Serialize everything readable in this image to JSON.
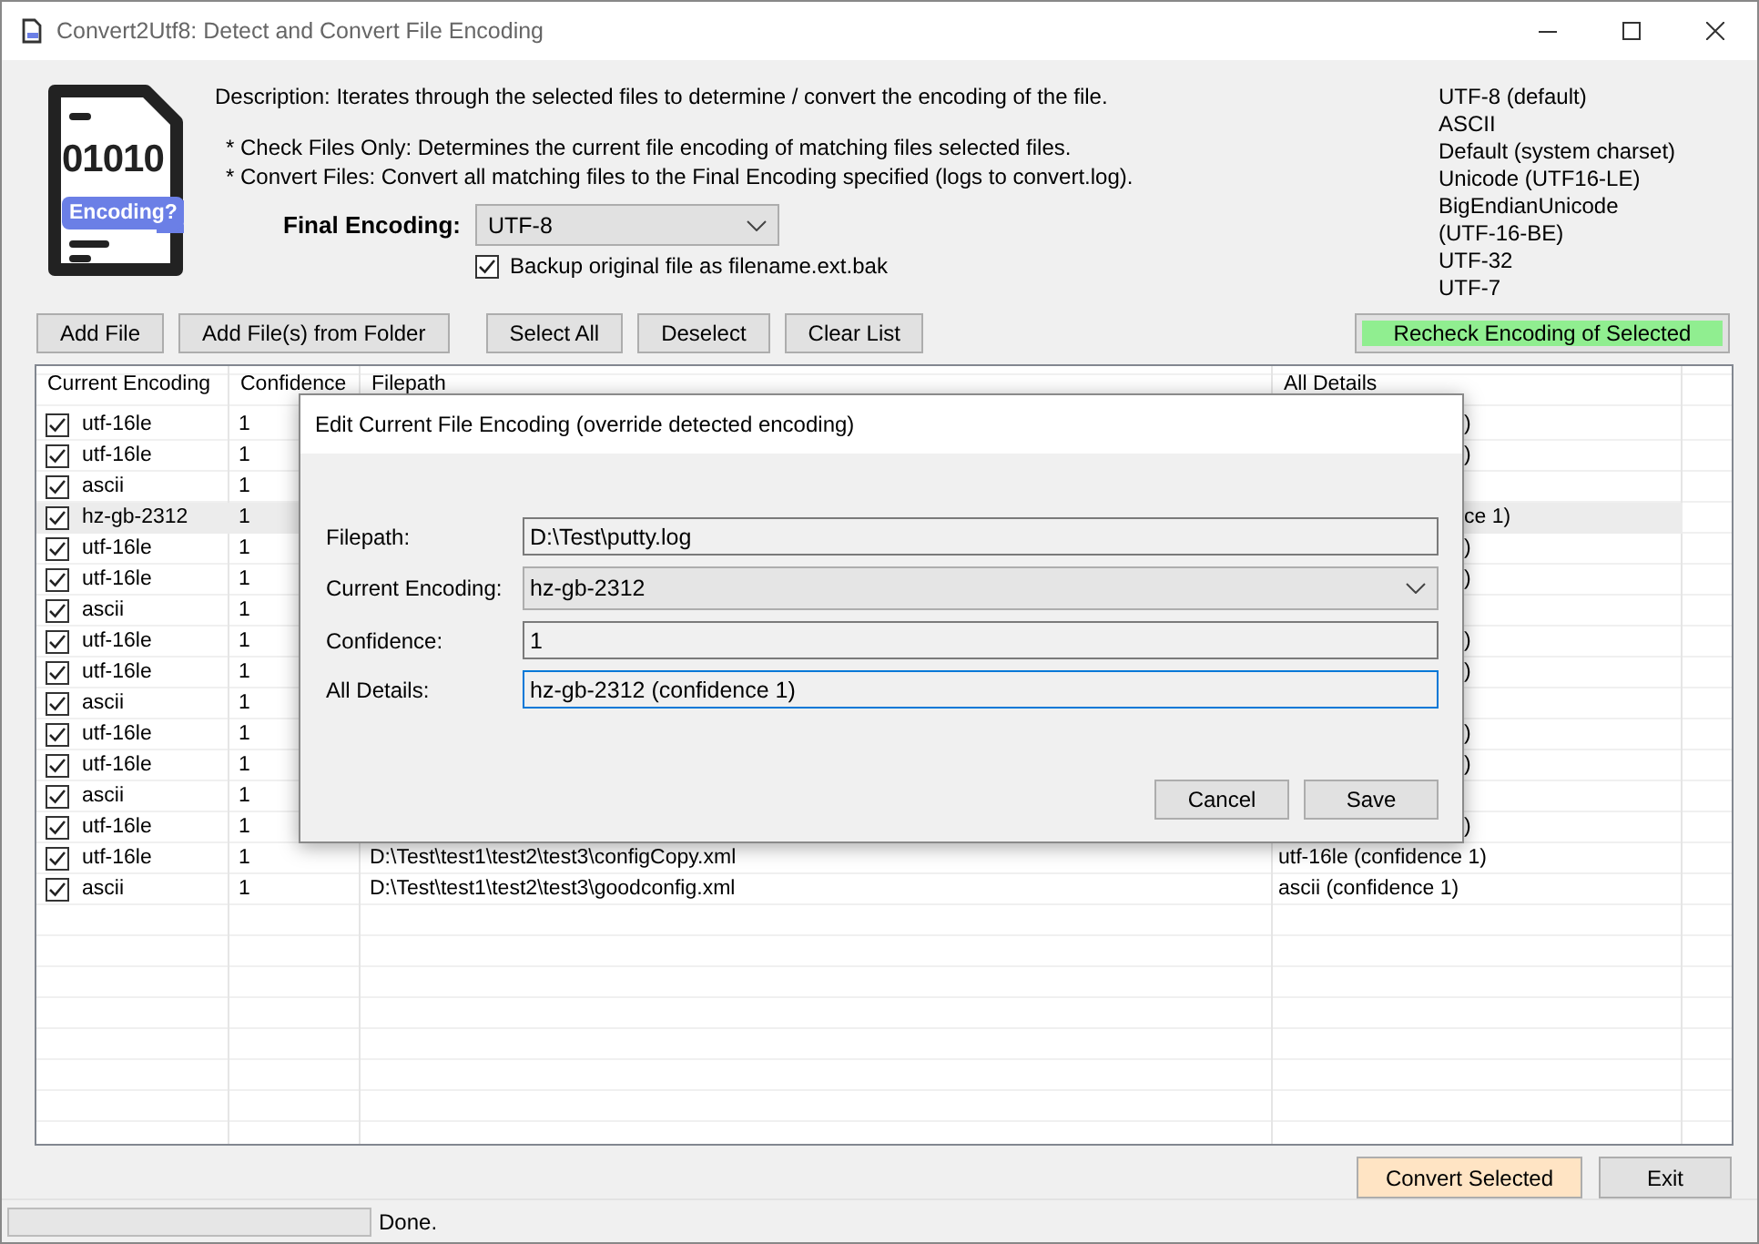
{
  "window": {
    "title": "Convert2Utf8: Detect and Convert File Encoding"
  },
  "logo": {
    "digits": "01010",
    "badge": "Encoding?"
  },
  "description": "Description: Iterates through the selected files to determine / convert the encoding of the file.",
  "notes": [
    "* Check Files Only: Determines the current file encoding of matching files selected files.",
    "* Convert Files: Convert all matching files to the Final Encoding specified (logs to convert.log)."
  ],
  "final_encoding": {
    "label": "Final Encoding:",
    "value": "UTF-8"
  },
  "backup": {
    "label": "Backup original file as filename.ext.bak",
    "checked": true
  },
  "encodings": [
    "UTF-8 (default)",
    "ASCII",
    "Default (system charset)",
    "Unicode (UTF16-LE)",
    "BigEndianUnicode",
    "(UTF-16-BE)",
    "UTF-32",
    "UTF-7"
  ],
  "toolbar": [
    "Add File",
    "Add File(s) from Folder",
    "Select All",
    "Deselect",
    "Clear List"
  ],
  "recheck_button": "Recheck Encoding of Selected",
  "table": {
    "columns": [
      "Current Encoding",
      "Confidence",
      "Filepath",
      "All Details"
    ],
    "rows": [
      {
        "checked": true,
        "selected": false,
        "encoding": "utf-16le",
        "confidence": "1",
        "all_details": ")"
      },
      {
        "checked": true,
        "selected": false,
        "encoding": "utf-16le",
        "confidence": "1",
        "all_details": ")"
      },
      {
        "checked": true,
        "selected": false,
        "encoding": "ascii",
        "confidence": "1"
      },
      {
        "checked": true,
        "selected": true,
        "encoding": "hz-gb-2312",
        "confidence": "1",
        "all_details": "ce 1)"
      },
      {
        "checked": true,
        "selected": false,
        "encoding": "utf-16le",
        "confidence": "1",
        "all_details": ")"
      },
      {
        "checked": true,
        "selected": false,
        "encoding": "utf-16le",
        "confidence": "1",
        "all_details": ")"
      },
      {
        "checked": true,
        "selected": false,
        "encoding": "ascii",
        "confidence": "1"
      },
      {
        "checked": true,
        "selected": false,
        "encoding": "utf-16le",
        "confidence": "1",
        "all_details": ")"
      },
      {
        "checked": true,
        "selected": false,
        "encoding": "utf-16le",
        "confidence": "1",
        "all_details": ")"
      },
      {
        "checked": true,
        "selected": false,
        "encoding": "ascii",
        "confidence": "1"
      },
      {
        "checked": true,
        "selected": false,
        "encoding": "utf-16le",
        "confidence": "1",
        "all_details": ")"
      },
      {
        "checked": true,
        "selected": false,
        "encoding": "utf-16le",
        "confidence": "1",
        "all_details": ")"
      },
      {
        "checked": true,
        "selected": false,
        "encoding": "ascii",
        "confidence": "1"
      },
      {
        "checked": true,
        "selected": false,
        "encoding": "utf-16le",
        "confidence": "1",
        "all_details": ")"
      },
      {
        "checked": true,
        "selected": false,
        "encoding": "utf-16le",
        "confidence": "1",
        "filepath": "D:\\Test\\test1\\test2\\test3\\configCopy.xml",
        "all_details": "utf-16le (confidence 1)"
      },
      {
        "checked": true,
        "selected": false,
        "encoding": "ascii",
        "confidence": "1",
        "filepath": "D:\\Test\\test1\\test2\\test3\\goodconfig.xml",
        "all_details": "ascii (confidence 1)"
      }
    ]
  },
  "bottom_buttons": [
    {
      "label": "Convert Selected",
      "kind": "primary"
    },
    {
      "label": "Exit",
      "kind": "normal"
    }
  ],
  "status_bar": {
    "text": "Done.",
    "level": 0
  },
  "dialog": {
    "title": "Edit Current File Encoding (override detected encoding)",
    "fields": [
      {
        "label": "Filepath:",
        "value": "D:\\Test\\putty.log",
        "kind": "text",
        "focused": false
      },
      {
        "label": "Current Encoding:",
        "value": "hz-gb-2312",
        "kind": "combo",
        "focused": false
      },
      {
        "label": "Confidence:",
        "value": "1",
        "kind": "text",
        "focused": false
      },
      {
        "label": "All Details:",
        "value": "hz-gb-2312 (confidence 1)",
        "kind": "text",
        "focused": true
      }
    ],
    "buttons": [
      "Cancel",
      "Save"
    ]
  }
}
